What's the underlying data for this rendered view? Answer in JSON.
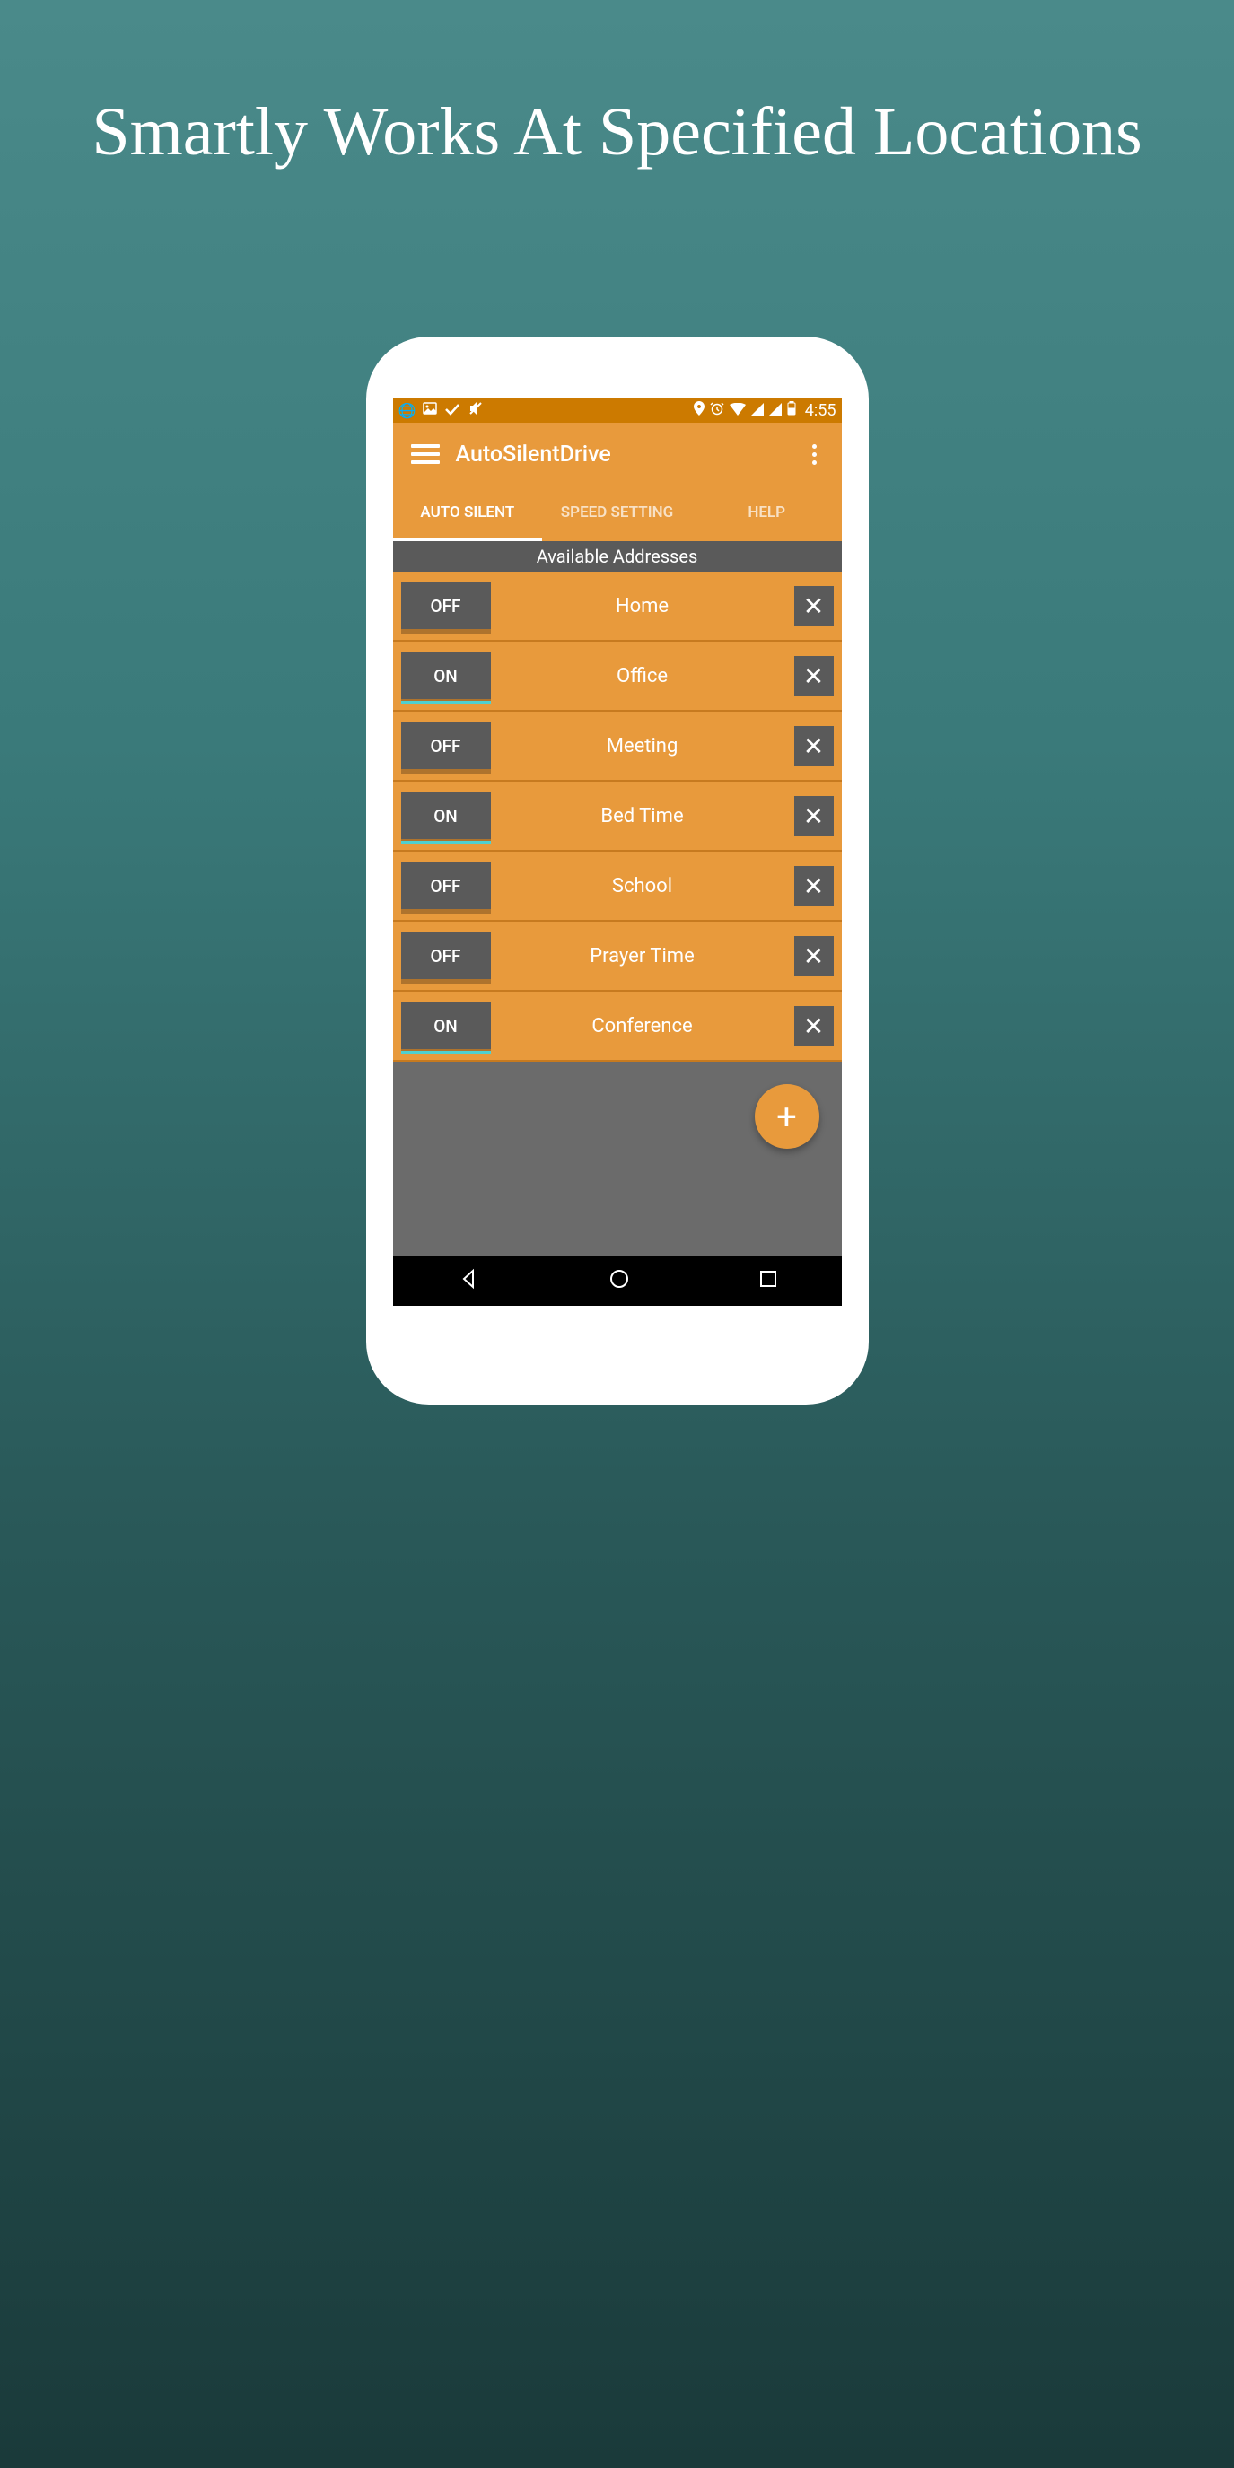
{
  "headline": "Smartly Works At Specified Locations",
  "statusBar": {
    "time": "4:55"
  },
  "app": {
    "title": "AutoSilentDrive"
  },
  "tabs": [
    {
      "label": "AUTO SILENT",
      "active": true
    },
    {
      "label": "SPEED SETTING",
      "active": false
    },
    {
      "label": "HELP",
      "active": false
    }
  ],
  "sectionHeader": "Available Addresses",
  "rows": [
    {
      "toggle": "OFF",
      "label": "Home"
    },
    {
      "toggle": "ON",
      "label": "Office"
    },
    {
      "toggle": "OFF",
      "label": "Meeting"
    },
    {
      "toggle": "ON",
      "label": "Bed Time"
    },
    {
      "toggle": "OFF",
      "label": "School"
    },
    {
      "toggle": "OFF",
      "label": "Prayer Time"
    },
    {
      "toggle": "ON",
      "label": "Conference"
    }
  ],
  "fab": "+",
  "deleteSymbol": "✕"
}
